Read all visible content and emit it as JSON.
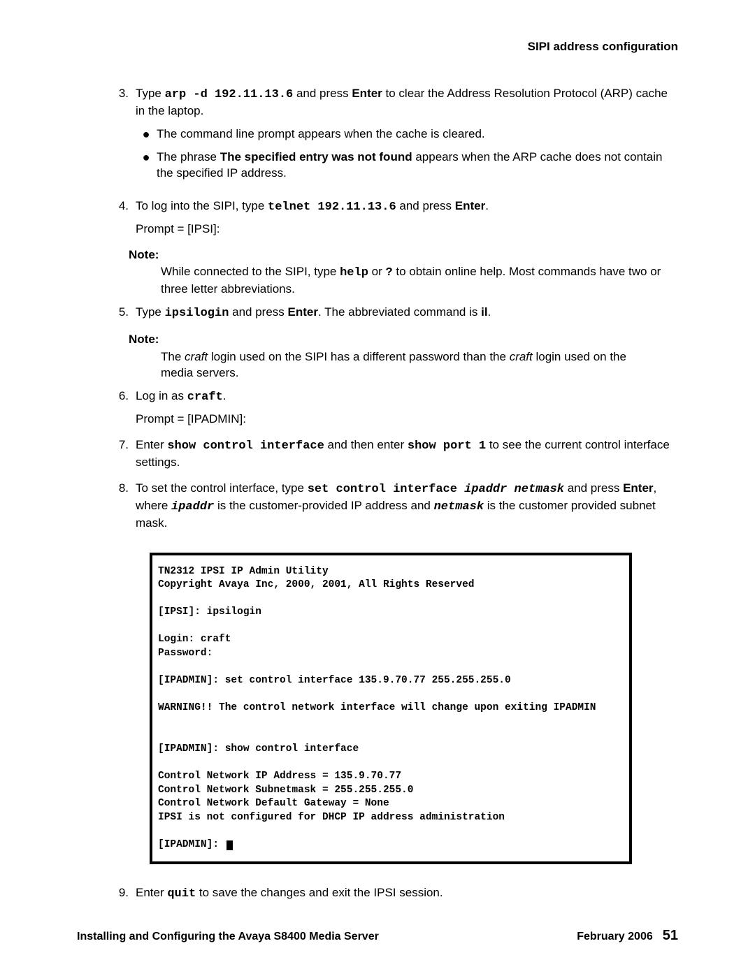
{
  "running_head": "SIPI address configuration",
  "steps": {
    "s3": {
      "marker": "3.",
      "t1": "Type ",
      "cmd": "arp -d 192.11.13.6",
      "t2": " and press ",
      "enter": "Enter",
      "t3": " to clear the Address Resolution Protocol (ARP) cache in the laptop.",
      "b1": "The command line prompt appears when the cache is cleared.",
      "b2a": "The phrase ",
      "b2b": "The specified entry was not found",
      "b2c": " appears when the ARP cache does not contain the specified IP address."
    },
    "s4": {
      "marker": "4.",
      "t1": "To log into the SIPI, type ",
      "cmd": "telnet 192.11.13.6",
      "t2": " and press ",
      "enter": "Enter",
      "t3": ".",
      "prompt": "Prompt = [IPSI]:"
    },
    "note1": {
      "label": "Note:",
      "a": "While connected to the SIPI, type ",
      "help": "help",
      "b": " or ",
      "q": "?",
      "c": " to obtain online help. Most commands have two or three letter abbreviations."
    },
    "s5": {
      "marker": "5.",
      "t1": "Type ",
      "cmd": "ipsilogin",
      "t2": " and press ",
      "enter": "Enter",
      "t3": ". The abbreviated command is ",
      "il": "il",
      "t4": "."
    },
    "note2": {
      "label": "Note:",
      "a": "The ",
      "craft1": "craft",
      "b": " login used on the SIPI has a different password than the ",
      "craft2": "craft",
      "c": " login used on the media servers."
    },
    "s6": {
      "marker": "6.",
      "t1": "Log in as ",
      "cmd": "craft",
      "t2": ".",
      "prompt": "Prompt = [IPADMIN]:"
    },
    "s7": {
      "marker": "7.",
      "t1": "Enter ",
      "cmd1": "show control interface",
      "t2": " and then enter ",
      "cmd2": "show port 1",
      "t3": " to see the current control interface settings."
    },
    "s8": {
      "marker": "8.",
      "t1": "To set the control interface, type ",
      "cmd": "set control interface ",
      "arg1": "ipaddr",
      "sp": " ",
      "arg2": "netmask",
      "t2": " and press ",
      "enter": "Enter",
      "t3": ", where ",
      "ip": "ipaddr",
      "t4": " is the customer-provided IP address and ",
      "nm": "netmask",
      "t5": " is the customer provided subnet mask."
    },
    "s9": {
      "marker": "9.",
      "t1": "Enter ",
      "cmd": "quit",
      "t2": " to save the changes and exit the IPSI session."
    }
  },
  "terminal": {
    "l1": "TN2312 IPSI IP Admin Utility",
    "l2": "Copyright Avaya Inc, 2000, 2001, All Rights Reserved",
    "l3": "",
    "l4": "[IPSI]: ipsilogin",
    "l5": "",
    "l6": "Login: craft",
    "l7": "Password:",
    "l8": "",
    "l9": "[IPADMIN]: set control interface 135.9.70.77 255.255.255.0",
    "l10": "",
    "l11": "WARNING!! The control network interface will change upon exiting IPADMIN",
    "l12": "",
    "l13": "",
    "l14": "[IPADMIN]: show control interface",
    "l15": "",
    "l16": "Control Network IP Address = 135.9.70.77",
    "l17": "Control Network Subnetmask = 255.255.255.0",
    "l18": "Control Network Default Gateway = None",
    "l19": "IPSI is not configured for DHCP IP address administration",
    "l20": "",
    "l21": "[IPADMIN]: "
  },
  "footer": {
    "left": "Installing and Configuring the Avaya S8400 Media Server",
    "date": "February 2006",
    "page": "51"
  }
}
